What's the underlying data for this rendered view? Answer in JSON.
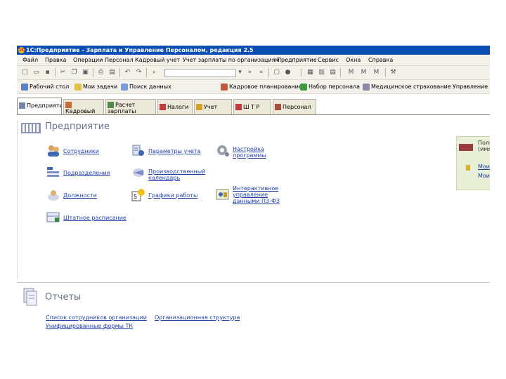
{
  "window": {
    "title": "1С:Предприятие - Зарплата и Управление Персоналом, редакция 2.5"
  },
  "menu": [
    "Файл",
    "Правка",
    "Операции",
    "Персонал",
    "Кадровый учет",
    "Учет зарплаты по организациям",
    "Предприятие",
    "Сервис",
    "Окна",
    "Справка"
  ],
  "quickbar": {
    "items": [
      "Рабочий стол",
      "Мои задачи",
      "Поиск данных",
      "Кадровое планирование",
      "Набор персонала",
      "Медицинское страхование",
      "Управление кадрами"
    ]
  },
  "tabs": [
    {
      "label": "Предприятие",
      "active": true
    },
    {
      "label": "Кадровый учет"
    },
    {
      "label": "Расчет зарплаты"
    },
    {
      "label": "Налоги"
    },
    {
      "label": "Учет"
    },
    {
      "label": "Ш Т Р"
    },
    {
      "label": "Персонал"
    }
  ],
  "enterprise": {
    "title": "Предприятие",
    "links": {
      "employees": "Сотрудники",
      "divisions": "Подразделения",
      "positions": "Должности",
      "staff": "Штатное расписание",
      "accounting_params": "Параметры учета",
      "calendar": "Производственный календарь",
      "schedules": "Графики работы",
      "program_setup": "Настройка программы",
      "interactive": "Интерактивное управление данными ПЗ-ФЗ"
    }
  },
  "side": {
    "title_line1": "Поль",
    "title_line2": "(имя",
    "link1": "Мои",
    "link2": "Мои"
  },
  "reports": {
    "title": "Отчеты",
    "links": {
      "employees_list": "Список сотрудников организации",
      "unified_forms": "Унифицированные формы ТК",
      "org_structure": "Организационная структура"
    }
  }
}
